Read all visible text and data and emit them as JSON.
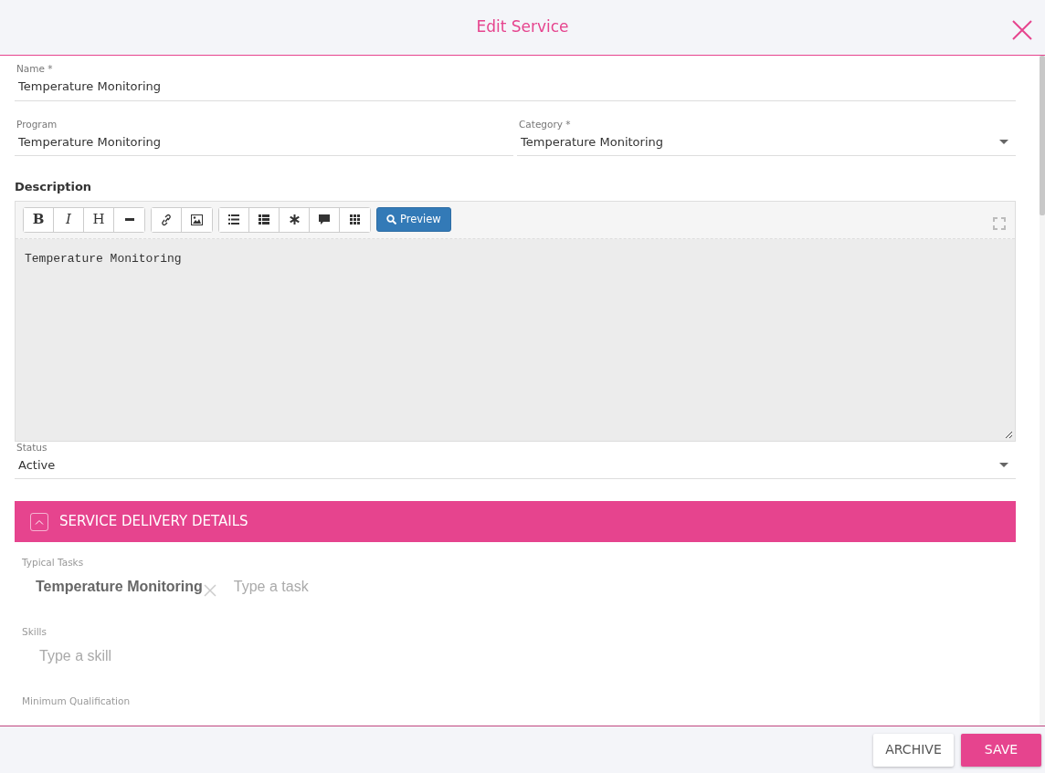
{
  "dialog": {
    "title": "Edit Service"
  },
  "name_field": {
    "label": "Name *",
    "value": "Temperature Monitoring"
  },
  "program_field": {
    "label": "Program",
    "value": "Temperature Monitoring"
  },
  "category_field": {
    "label": "Category *",
    "value": "Temperature Monitoring"
  },
  "description": {
    "label": "Description",
    "content": "Temperature Monitoring",
    "toolbar": [
      [
        {
          "kind": "bold",
          "label": "B"
        },
        {
          "kind": "italic",
          "label": "I"
        },
        {
          "kind": "heading",
          "label": "H"
        },
        {
          "kind": "rule"
        }
      ],
      [
        {
          "kind": "link"
        },
        {
          "kind": "image"
        }
      ],
      [
        {
          "kind": "bullet-list"
        },
        {
          "kind": "numbered-list"
        },
        {
          "kind": "asterisk"
        },
        {
          "kind": "comment"
        },
        {
          "kind": "grid"
        }
      ]
    ],
    "preview_button": "Preview"
  },
  "status_field": {
    "label": "Status",
    "value": "Active"
  },
  "section": {
    "title": "SERVICE DELIVERY DETAILS",
    "expanded": true
  },
  "typical_tasks": {
    "label": "Typical Tasks",
    "tags": [
      "Temperature Monitoring"
    ],
    "placeholder": "Type a task"
  },
  "skills": {
    "label": "Skills",
    "placeholder": "Type a skill"
  },
  "minimum_qualification": {
    "label": "Minimum Qualification"
  },
  "footer_buttons": [
    {
      "kind": "secondary",
      "label": "ARCHIVE"
    },
    {
      "kind": "primary",
      "label": "SAVE"
    }
  ]
}
